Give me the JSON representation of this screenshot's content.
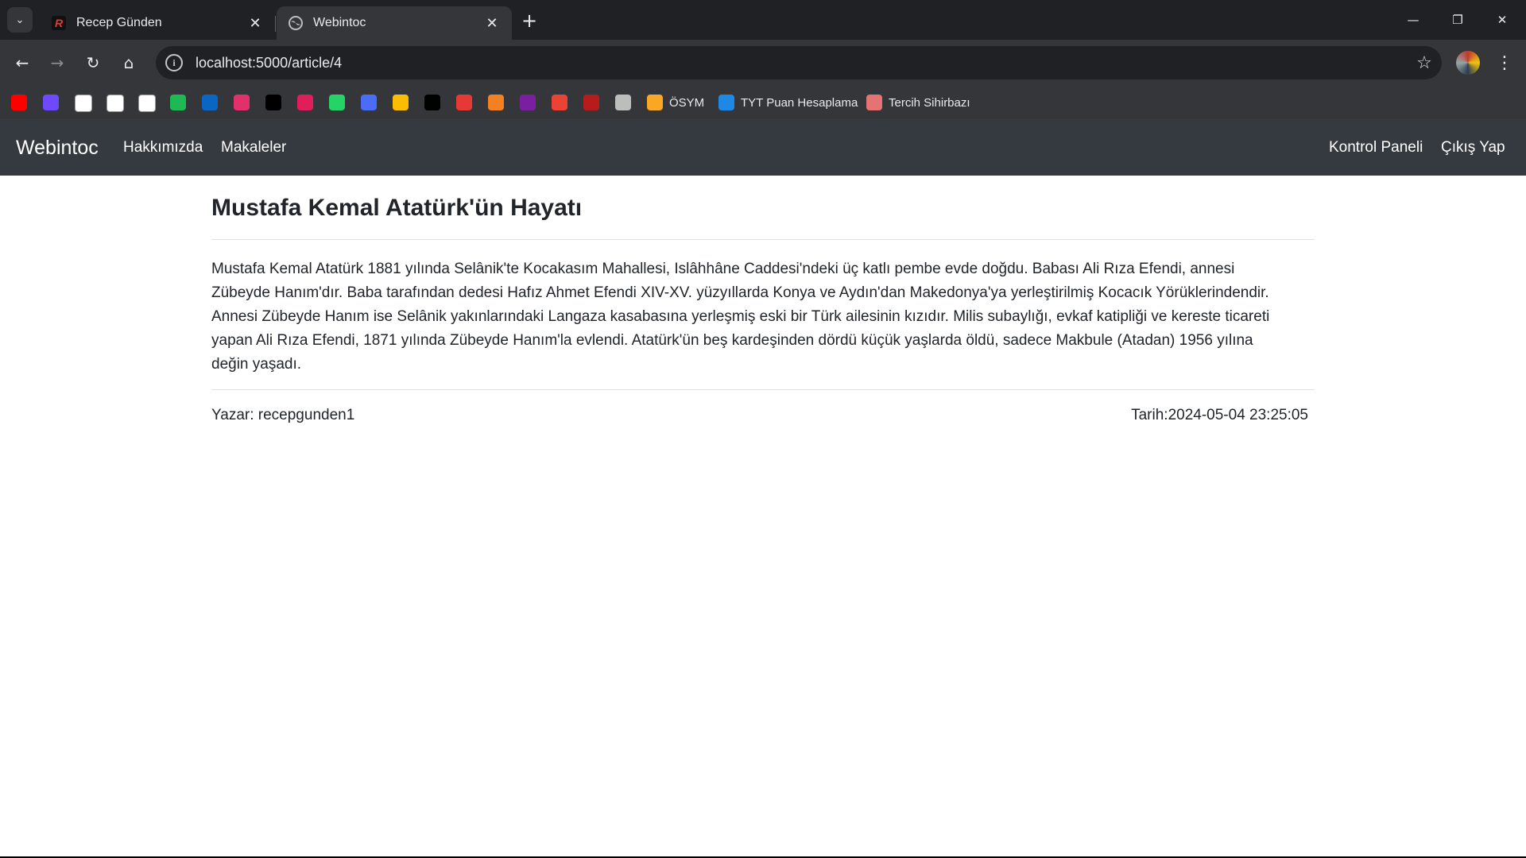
{
  "browser": {
    "tabs": [
      {
        "title": "Recep Günden",
        "favicon": "r-logo-icon",
        "active": false
      },
      {
        "title": "Webintoc",
        "favicon": "globe-icon",
        "active": true
      }
    ],
    "url": "localhost:5000/article/4",
    "bookmarks": [
      {
        "icon": "youtube-icon",
        "color": "#ff0000"
      },
      {
        "icon": "proton-icon",
        "color": "#6d4aff"
      },
      {
        "icon": "github-icon",
        "color": "#ffffff"
      },
      {
        "icon": "chatgpt-icon",
        "color": "#ffffff"
      },
      {
        "icon": "google-icon",
        "color": "#ffffff"
      },
      {
        "icon": "spotify-icon",
        "color": "#1db954"
      },
      {
        "icon": "linkedin-icon",
        "color": "#0a66c2"
      },
      {
        "icon": "instagram-icon",
        "color": "#e1306c"
      },
      {
        "icon": "x-icon",
        "color": "#000000"
      },
      {
        "icon": "slack-icon",
        "color": "#e01e5a"
      },
      {
        "icon": "whatsapp-icon",
        "color": "#25d366"
      },
      {
        "icon": "messenger-icon",
        "color": "#4a6cf7"
      },
      {
        "icon": "photos-icon",
        "color": "#fbbc04"
      },
      {
        "icon": "notion-icon",
        "color": "#000000"
      },
      {
        "icon": "settings-hex-icon",
        "color": "#e53935"
      },
      {
        "icon": "stack-icon",
        "color": "#f48024"
      },
      {
        "icon": "k-icon",
        "color": "#7b1fa2"
      },
      {
        "icon": "gmail-icon",
        "color": "#ea4335"
      },
      {
        "icon": "r-logo-icon",
        "color": "#b71c1c"
      },
      {
        "icon": "globe-icon",
        "color": "#bdbdbd"
      }
    ],
    "bookmark_links": [
      {
        "label": "ÖSYM",
        "icon": "osym-icon",
        "color": "#f9a825"
      },
      {
        "label": "TYT Puan Hesaplama",
        "icon": "h-icon",
        "color": "#1e88e5"
      },
      {
        "label": "Tercih Sihirbazı",
        "icon": "tercih-icon",
        "color": "#e57373"
      }
    ]
  },
  "navbar": {
    "brand": "Webintoc",
    "left_links": [
      "Hakkımızda",
      "Makaleler"
    ],
    "right_links": [
      "Kontrol Paneli",
      "Çıkış Yap"
    ]
  },
  "article": {
    "title": "Mustafa Kemal Atatürk'ün Hayatı",
    "body_lines": [
      "Mustafa Kemal Atatürk 1881 yılında Selânik'te Kocakasım Mahallesi, Islâhhâne Caddesi'ndeki üç katlı pembe evde doğdu. Babası Ali Rıza Efendi, annesi",
      "Zübeyde Hanım'dır. Baba tarafından dedesi Hafız Ahmet Efendi XIV-XV. yüzyıllarda Konya ve Aydın'dan Makedonya'ya yerleştirilmiş Kocacık Yörüklerindendir.",
      "Annesi Zübeyde Hanım ise Selânik yakınlarındaki Langaza kasabasına yerleşmiş eski bir Türk ailesinin kızıdır. Milis subaylığı, evkaf katipliği ve kereste ticareti",
      "yapan Ali Rıza Efendi, 1871 yılında Zübeyde Hanım'la evlendi. Atatürk'ün beş kardeşinden dördü küçük yaşlarda öldü, sadece Makbule (Atadan) 1956 yılına",
      "değin yaşadı."
    ],
    "author": "Yazar: recepgunden1",
    "date": "Tarih:2024-05-04 23:25:05"
  }
}
